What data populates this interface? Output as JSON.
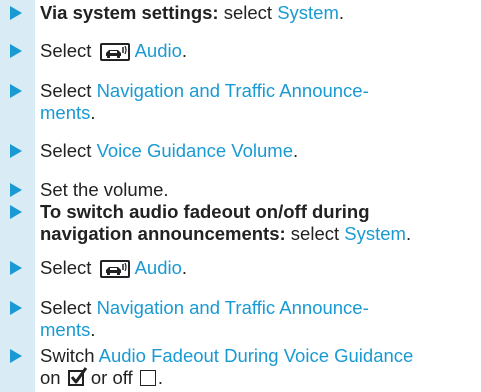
{
  "steps": [
    {
      "prefix_bold": "Via system settings:",
      "text_before": " select ",
      "link": "System",
      "text_after": "."
    },
    {
      "text_before": "Select ",
      "icon": "radio-icon",
      "link": "Audio",
      "text_after": "."
    },
    {
      "text_before": "Select ",
      "link_line1": "Navigation and Traffic Announce-",
      "link_line2": "ments",
      "text_after": "."
    },
    {
      "text_before": "Select ",
      "link": "Voice Guidance Volume",
      "text_after": "."
    },
    {
      "text": "Set the volume."
    },
    {
      "prefix_bold_line1": "To switch audio fadeout on/off during",
      "prefix_bold_line2": "navigation announcements:",
      "text_before": " select ",
      "link": "System",
      "text_after": "."
    },
    {
      "text_before": "Select ",
      "icon": "radio-icon",
      "link": "Audio",
      "text_after": "."
    },
    {
      "text_before": "Select ",
      "link_line1": "Navigation and Traffic Announce-",
      "link_line2": "ments",
      "text_after": "."
    },
    {
      "text_before": "Switch ",
      "link": "Audio Fadeout During Voice Guidance",
      "line2_before": "on ",
      "checkbox_on": "checked-checkbox-icon",
      "line2_middle": " or off ",
      "checkbox_off": "empty-checkbox-icon",
      "text_after": "."
    }
  ],
  "colors": {
    "accent": "#199ad3",
    "bar": "#d9ecf6",
    "text": "#222222"
  }
}
